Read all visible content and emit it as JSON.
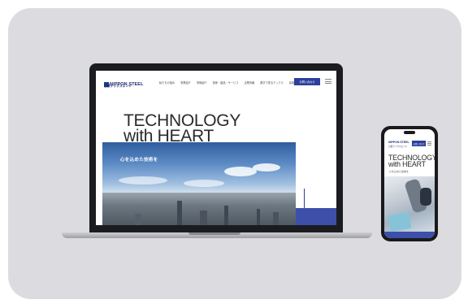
{
  "site": {
    "logo": "NIPPON STEEL",
    "logo_sub": "日鉄テックスエンジ",
    "nav": [
      "私たちの強み",
      "事業紹介",
      "事例紹介",
      "技術・製品・サービス",
      "企業情報",
      "数字で見るテックス",
      "採用情報"
    ],
    "cta": "お問い合わせ",
    "hero_title_line1": "TECHNOLOGY",
    "hero_title_line2": "with HEART",
    "hero_sub": "心を込めた技術を"
  },
  "phone": {
    "logo": "NIPPON STEEL",
    "logo_sub": "日鉄テックスエンジ",
    "cta": "お問い合わせ",
    "title_line1": "TECHNOLOGY",
    "title_line2": "with HEART",
    "sub": "心を込めた技術を"
  },
  "colors": {
    "panel": "#dcdce0",
    "brand_blue": "#2d3f9a",
    "laptop_frame": "#1b1c1f"
  },
  "icons": [
    "hamburger-menu-icon"
  ]
}
